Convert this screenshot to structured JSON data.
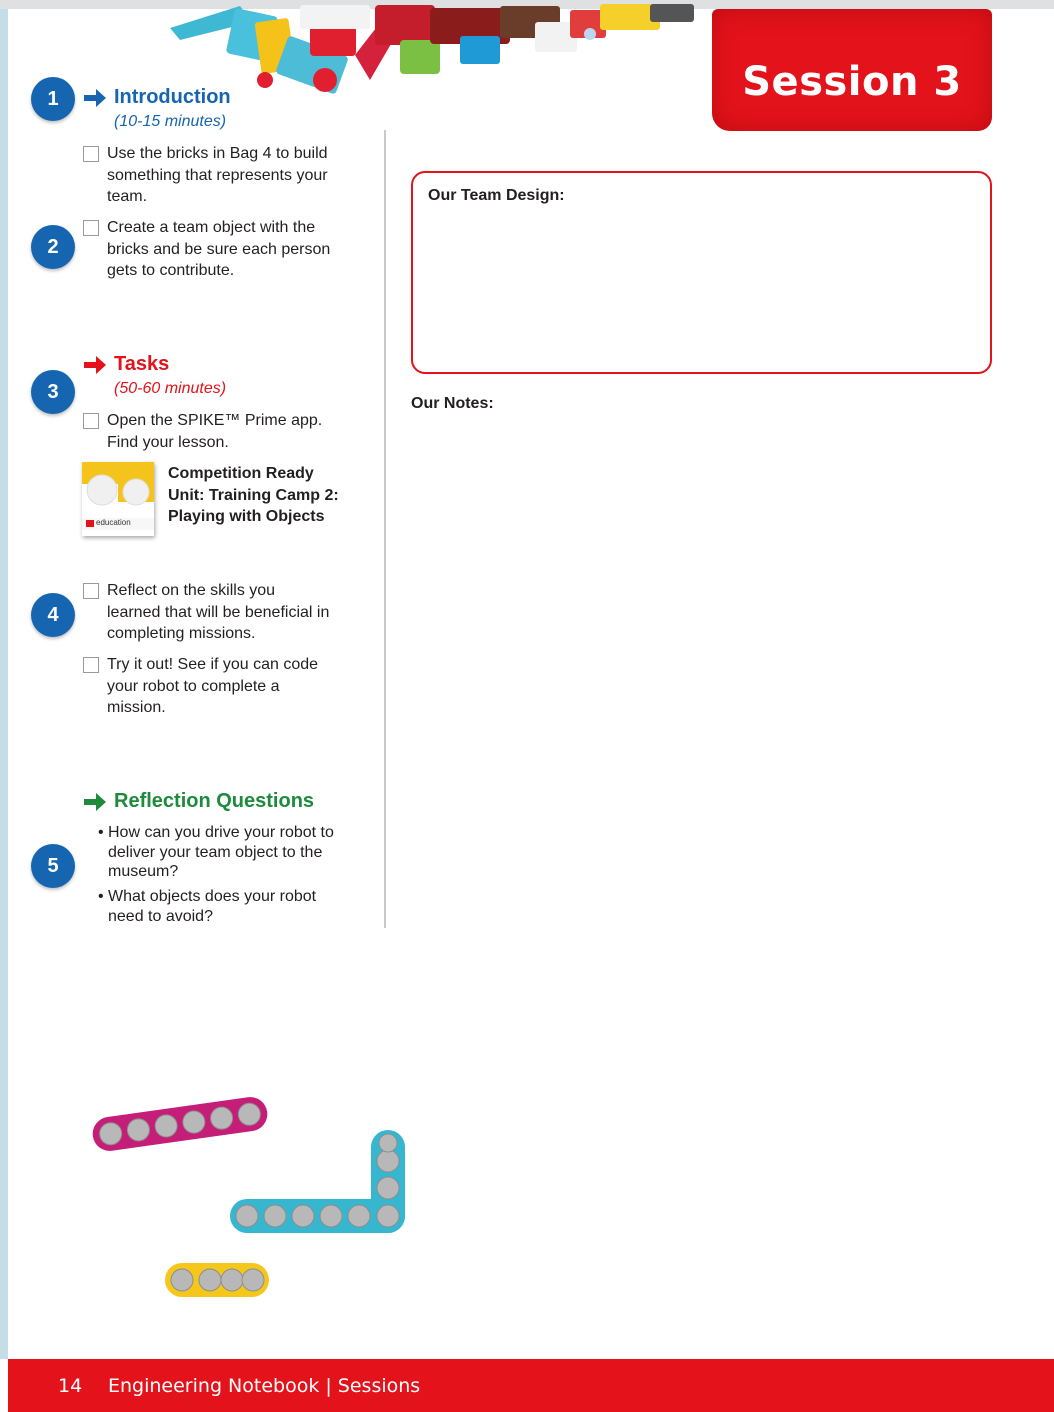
{
  "session_badge": "Session 3",
  "steps": [
    "1",
    "2",
    "3",
    "4",
    "5"
  ],
  "introduction": {
    "title": "Introduction",
    "time": "(10-15 minutes)",
    "items": [
      [
        "Use the bricks in Bag 4 to build",
        "something that represents your",
        "team."
      ],
      [
        "Create a team object with the",
        "bricks and be sure each person",
        "gets to contribute."
      ]
    ]
  },
  "tasks": {
    "title": "Tasks",
    "time": "(50-60 minutes)",
    "items": [
      [
        "Open the SPIKE™ Prime app.",
        "Find your lesson."
      ],
      [
        "Reflect on the skills you",
        "learned that will be beneficial in",
        "completing missions."
      ],
      [
        "Try it out! See if you can code",
        "your robot to complete a",
        "mission."
      ]
    ],
    "lesson": {
      "lines": [
        "Competition Ready",
        "Unit: Training Camp 2:",
        "Playing with Objects"
      ],
      "thumb_text": "education"
    }
  },
  "reflection": {
    "title": "Reflection Questions",
    "questions": [
      [
        "How can you drive your robot to",
        "deliver your team object to the",
        "museum?"
      ],
      [
        "What objects does your robot",
        "need to avoid?"
      ]
    ]
  },
  "design_box_label": "Our Team Design:",
  "notes_label": "Our Notes:",
  "footer": {
    "page_number": "14",
    "title": "Engineering Notebook | Sessions"
  },
  "colors": {
    "brand_red": "#e3121b",
    "intro_blue": "#1565b0",
    "tasks_red": "#e3121b",
    "reflection_green": "#1e8a3c"
  }
}
